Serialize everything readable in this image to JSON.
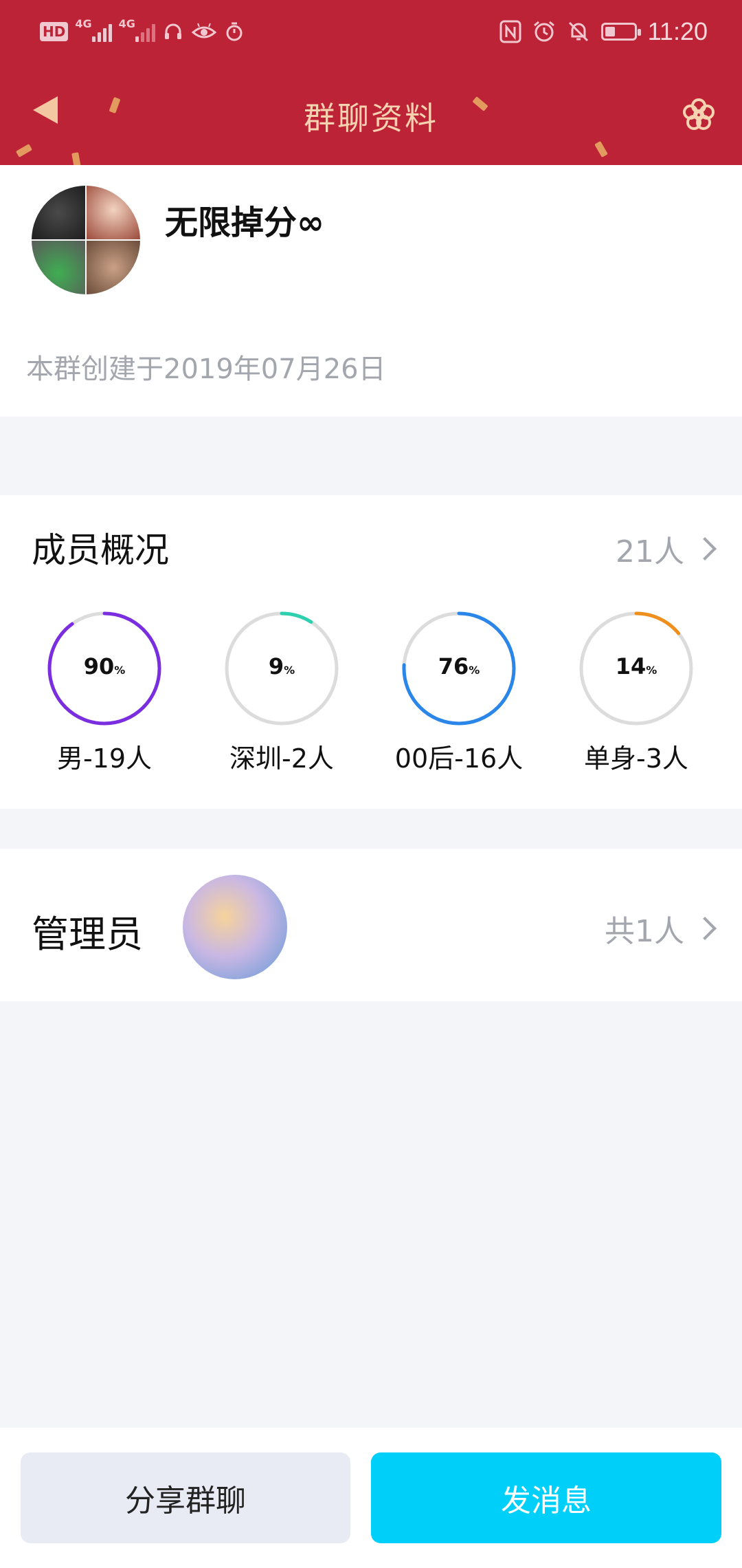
{
  "status_bar": {
    "left_badge": "HD",
    "network_1": "4G",
    "network_2": "4G",
    "time": "11:20"
  },
  "nav": {
    "title": "群聊资料",
    "back_icon": "back-arrow-icon",
    "settings_icon": "flower-settings-icon"
  },
  "group": {
    "name": "无限掉分∞",
    "created": "本群创建于2019年07月26日"
  },
  "members": {
    "title": "成员概况",
    "count": "21人",
    "stats": [
      {
        "percent": "90",
        "unit": "%",
        "label": "男-19人",
        "value": 0.9,
        "color": "#7a2ee0"
      },
      {
        "percent": "9",
        "unit": "%",
        "label": "深圳-2人",
        "value": 0.09,
        "color": "#2fd0b0"
      },
      {
        "percent": "76",
        "unit": "%",
        "label": "00后-16人",
        "value": 0.76,
        "color": "#2a86e8"
      },
      {
        "percent": "14",
        "unit": "%",
        "label": "单身-3人",
        "value": 0.14,
        "color": "#f0901c"
      }
    ]
  },
  "admin": {
    "title": "管理员",
    "count": "共1人"
  },
  "actions": {
    "share": "分享群聊",
    "send": "发消息"
  },
  "colors": {
    "header": "#bd2336",
    "title_text": "#f7d2b1",
    "send_button": "#00cff9",
    "share_button": "#e8ebf4",
    "ring_track": "#dcdcdc"
  }
}
